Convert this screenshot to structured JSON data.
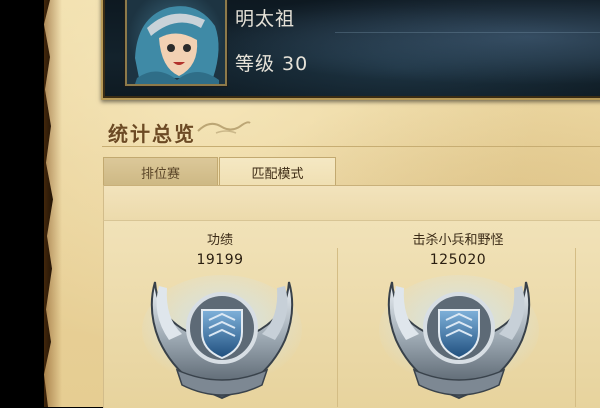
{
  "profile": {
    "name": "明太祖",
    "level": "等级 30"
  },
  "stats_section": {
    "title": "统计总览"
  },
  "tabs": [
    {
      "label": "排位赛",
      "active": false
    },
    {
      "label": "匹配模式",
      "active": true
    }
  ],
  "stats": [
    {
      "label": "功绩",
      "value": "19199",
      "emblem": "silver-shield-emblem"
    },
    {
      "label": "击杀小兵和野怪",
      "value": "125020",
      "emblem": "silver-shield-emblem"
    }
  ],
  "colors": {
    "parchment": "#e9d29a",
    "banner_bg": "#13222c",
    "gold_border": "#b79a57",
    "title_brown": "#6c4a24"
  }
}
